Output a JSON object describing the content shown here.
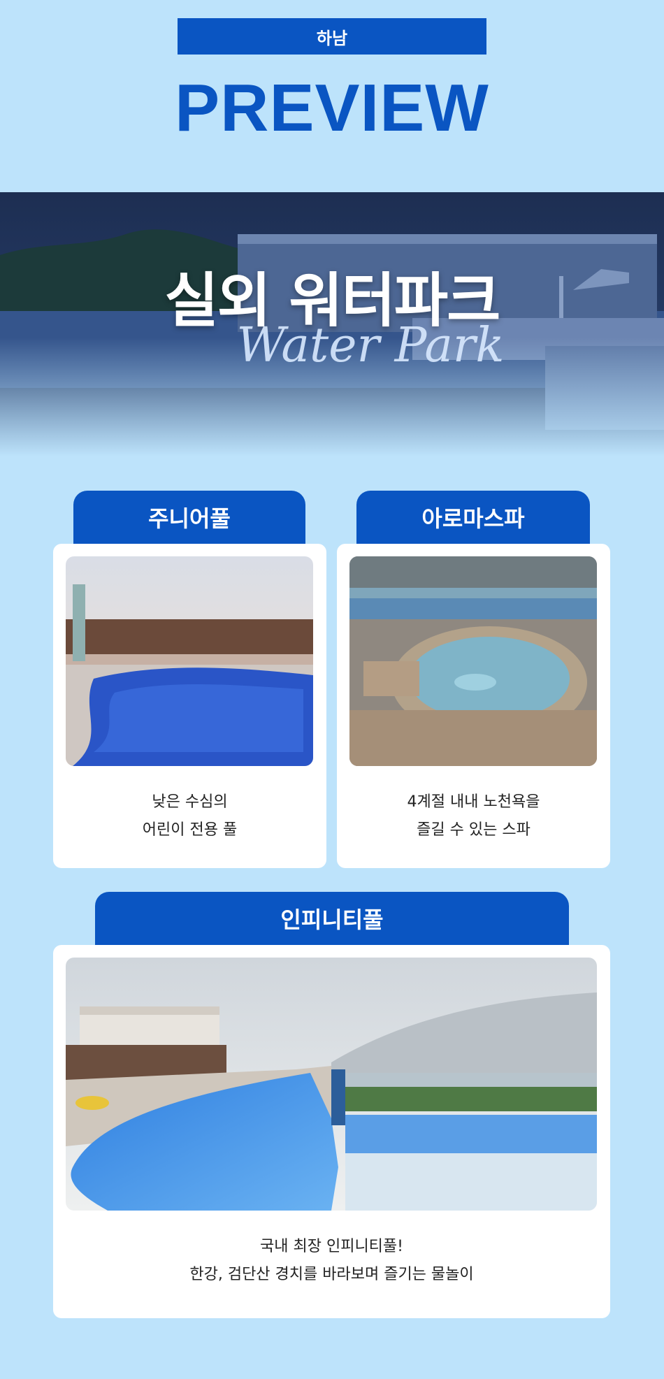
{
  "header": {
    "location": "하남",
    "title": "PREVIEW"
  },
  "hero": {
    "title": "실외 워터파크",
    "subtitle": "Water Park"
  },
  "sections": [
    {
      "tab": "주니어풀",
      "caption_line1": "낮은 수심의",
      "caption_line2": "어린이 전용 풀"
    },
    {
      "tab": "아로마스파",
      "caption_line1": "4계절 내내 노천욕을",
      "caption_line2": "즐길 수 있는 스파"
    },
    {
      "tab": "인피니티풀",
      "caption_line1": "국내 최장 인피니티풀!",
      "caption_line2": "한강, 검단산 경치를 바라보며 즐기는 물놀이"
    }
  ],
  "colors": {
    "background": "#bde3fb",
    "accent": "#0a55c2"
  }
}
